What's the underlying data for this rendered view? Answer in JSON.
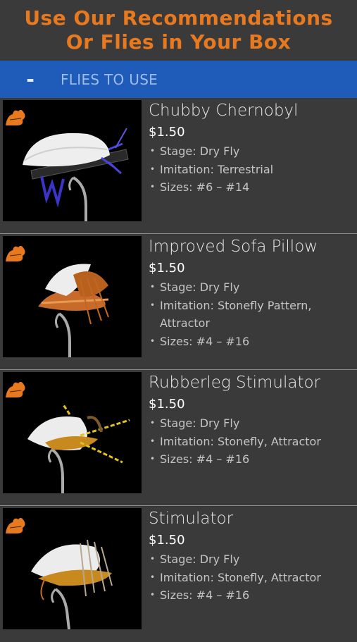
{
  "header": {
    "line1": "Use Our Recommendations",
    "line2": "Or Flies in Your Box",
    "accent_color": "#e8791f"
  },
  "section": {
    "toggle_symbol": "-",
    "title": "FLIES TO USE",
    "bar_color": "#1f5bb8"
  },
  "flies": [
    {
      "name": "Chubby Chernobyl",
      "price": "$1.50",
      "stage": "Stage: Dry Fly",
      "imitation": "Imitation: Terrestrial",
      "sizes": "Sizes: #6 – #14",
      "icon": "fly-logo-icon"
    },
    {
      "name": "Improved Sofa Pillow",
      "price": "$1.50",
      "stage": "Stage: Dry Fly",
      "imitation": "Imitation: Stonefly Pattern, Attractor",
      "sizes": "Sizes: #4 – #16",
      "icon": "fly-logo-icon"
    },
    {
      "name": "Rubberleg Stimulator",
      "price": "$1.50",
      "stage": "Stage: Dry Fly",
      "imitation": "Imitation: Stonefly, Attractor",
      "sizes": "Sizes: #4 – #16",
      "icon": "fly-logo-icon"
    },
    {
      "name": "Stimulator",
      "price": "$1.50",
      "stage": "Stage: Dry Fly",
      "imitation": "Imitation: Stonefly, Attractor",
      "sizes": "Sizes: #4 – #16",
      "icon": "fly-logo-icon"
    }
  ]
}
